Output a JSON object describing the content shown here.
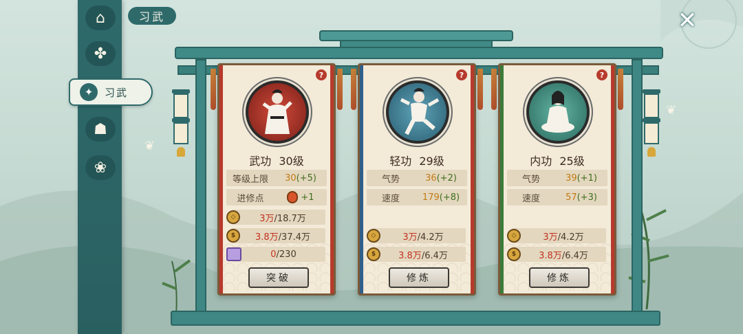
{
  "header": {
    "title": "习武"
  },
  "sidebar": {
    "items": [
      {
        "icon": "pavilion-icon"
      },
      {
        "icon": "crane-icon"
      },
      {
        "icon": "martial-arts-icon",
        "label": "习武",
        "active": true
      },
      {
        "icon": "meditation-icon"
      },
      {
        "icon": "scroll-cloud-icon"
      }
    ]
  },
  "cards": [
    {
      "name": "武功",
      "level": "30级",
      "accent": "#b73a2c",
      "portrait_bg": "#b33a30",
      "stats": [
        {
          "key": "等级上限",
          "base": "30",
          "bonus": "(+5)"
        },
        {
          "key": "进修点",
          "base": "",
          "bonus": "+1"
        }
      ],
      "costs": [
        {
          "icon": "copper-coin-icon",
          "have": "3万",
          "need": "/18.7万"
        },
        {
          "icon": "gold-coin-icon",
          "have": "3.8万",
          "need": "/37.4万"
        },
        {
          "icon": "scroll-item-icon",
          "have": "0",
          "need": "/230"
        }
      ],
      "button": "突破"
    },
    {
      "name": "轻功",
      "level": "29级",
      "accent": "#2f5f8a",
      "portrait_bg": "#3d7a96",
      "stats": [
        {
          "key": "气势",
          "base": "36",
          "bonus": "(+2)"
        },
        {
          "key": "速度",
          "base": "179",
          "bonus": "(+8)"
        }
      ],
      "costs": [
        {
          "icon": "copper-coin-icon",
          "have": "3万",
          "need": "/4.2万"
        },
        {
          "icon": "gold-coin-icon",
          "have": "3.8万",
          "need": "/6.4万"
        }
      ],
      "button": "修炼"
    },
    {
      "name": "内功",
      "level": "25级",
      "accent": "#3c7a3a",
      "portrait_bg": "#3f8f7f",
      "stats": [
        {
          "key": "气势",
          "base": "39",
          "bonus": "(+1)"
        },
        {
          "key": "速度",
          "base": "57",
          "bonus": "(+3)"
        }
      ],
      "costs": [
        {
          "icon": "copper-coin-icon",
          "have": "3万",
          "need": "/4.2万"
        },
        {
          "icon": "gold-coin-icon",
          "have": "3.8万",
          "need": "/6.4万"
        }
      ],
      "button": "修炼"
    }
  ]
}
